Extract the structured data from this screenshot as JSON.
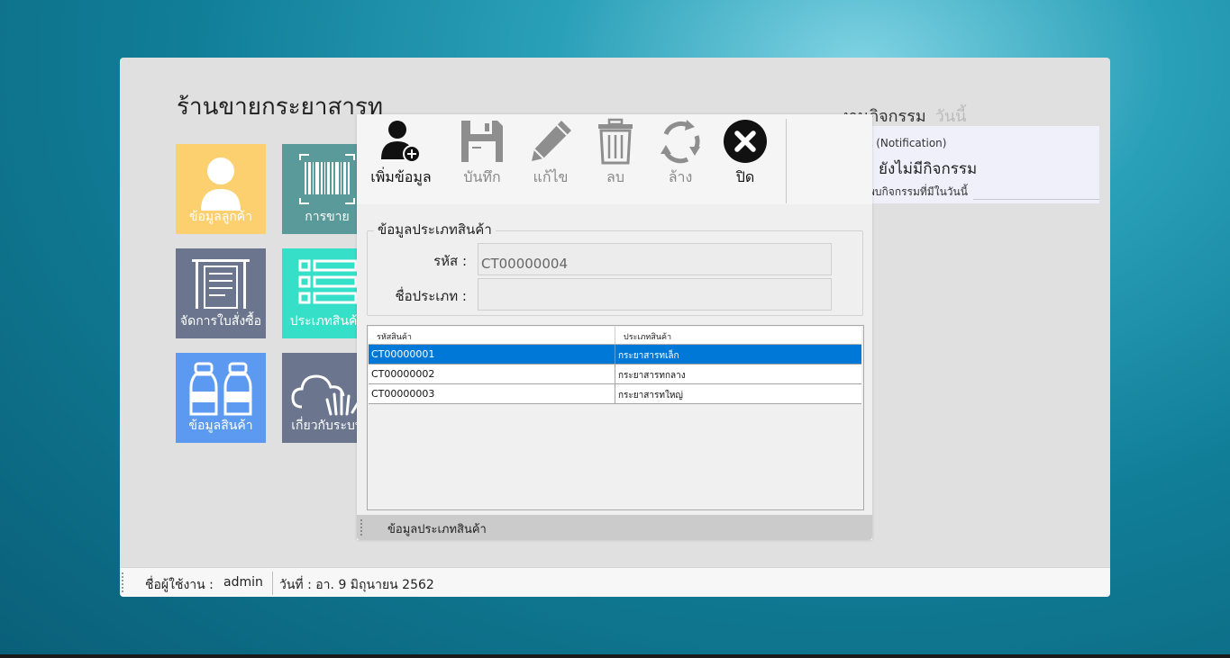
{
  "app": {
    "title": "ร้านขายกระยาสารท"
  },
  "tiles": [
    {
      "label": "ข้อมูลลูกค้า",
      "icon": "user-icon",
      "color": "#fcd06e"
    },
    {
      "label": "การขาย",
      "icon": "barcode-icon",
      "color": "#5a9a9a"
    },
    {
      "label": "จัดการใบสั่งซื้อ",
      "icon": "shelf-icon",
      "color": "#6b758d"
    },
    {
      "label": "ประเภทสินค้า",
      "icon": "list-icon",
      "color": "#35dfc8"
    },
    {
      "label": "ข้อมูลสินค้า",
      "icon": "bottles-icon",
      "color": "#5b9af0"
    },
    {
      "label": "เกี่ยวกับระบบ",
      "icon": "cloud-hand-icon",
      "color": "#6b758d"
    }
  ],
  "activity": {
    "title": "งานกิจกรรม",
    "today": "วันนี้",
    "notify_header": "อน (Notification)",
    "notify_main": "ยังไม่มีกิจกรรม",
    "notify_sub": "พบกิจกรรมที่มีในวันนี้"
  },
  "status": {
    "user_label": "ชื่อผู้ใช้งาน :",
    "user": "admin",
    "date": "วันที่ : อา. 9 มิถุนายน 2562"
  },
  "dialog": {
    "ribbon": {
      "add": "เพิ่มข้อมูล",
      "save": "บันทึก",
      "edit": "แก้ไข",
      "delete": "ลบ",
      "clear": "ล้าง",
      "close": "ปิด"
    },
    "group_title": "ข้อมูลประเภทสินค้า",
    "code_label": "รหัส :",
    "code_value": "CT00000004",
    "name_label": "ชื่อประเภท :",
    "name_value": "",
    "grid": {
      "headers": [
        "รหัสสินค้า",
        "ประเภทสินค้า"
      ],
      "rows": [
        {
          "code": "CT00000001",
          "name": "กระยาสารทเล็ก",
          "selected": true
        },
        {
          "code": "CT00000002",
          "name": "กระยาสารทกลาง",
          "selected": false
        },
        {
          "code": "CT00000003",
          "name": "กระยาสารทใหญ่",
          "selected": false
        }
      ]
    },
    "status_text": "ข้อมูลประเภทสินค้า"
  }
}
